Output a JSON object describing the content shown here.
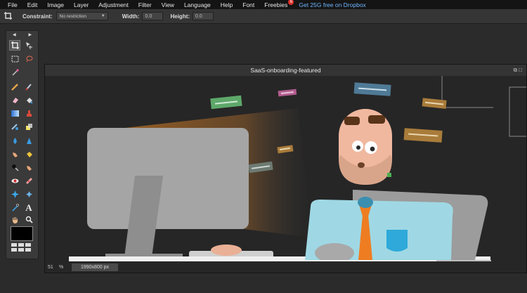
{
  "menu": {
    "items": [
      "File",
      "Edit",
      "Image",
      "Layer",
      "Adjustment",
      "Filter",
      "View",
      "Language",
      "Help",
      "Font",
      "Freebies"
    ],
    "freebies_badge": "6",
    "promo": "Get 25G free on Dropbox"
  },
  "options": {
    "constraint_label": "Constraint:",
    "constraint_value": "No restriction",
    "width_label": "Width:",
    "width_value": "0.0",
    "height_label": "Height:",
    "height_value": "0.0"
  },
  "document": {
    "title": "SaaS-onboarding-featured",
    "zoom": "51",
    "zoom_unit": "%",
    "dimensions": "1990x800 px"
  },
  "tools": [
    "crop-tool-icon",
    "move-tool-icon",
    "marquee-tool-icon",
    "lasso-tool-icon",
    "wand-tool-icon",
    "pencil-tool-icon",
    "brush-tool-icon",
    "eraser-tool-icon",
    "fill-tool-icon",
    "gradient-tool-icon",
    "stamp-tool-icon",
    "replace-color-icon",
    "drawing-tool-icon",
    "blur-tool-icon",
    "sharpen-tool-icon",
    "smudge-tool-icon",
    "sponge-tool-icon",
    "dodge-tool-icon",
    "burn-tool-icon",
    "red-eye-tool-icon",
    "spot-heal-tool-icon",
    "bloat-tool-icon",
    "pinch-tool-icon",
    "color-picker-icon",
    "type-tool-icon",
    "hand-tool-icon",
    "zoom-tool-icon"
  ],
  "colors": {
    "menubar_bg": "#141414",
    "accent_link": "#6fb7ff",
    "foreground_swatch": "#000000"
  }
}
